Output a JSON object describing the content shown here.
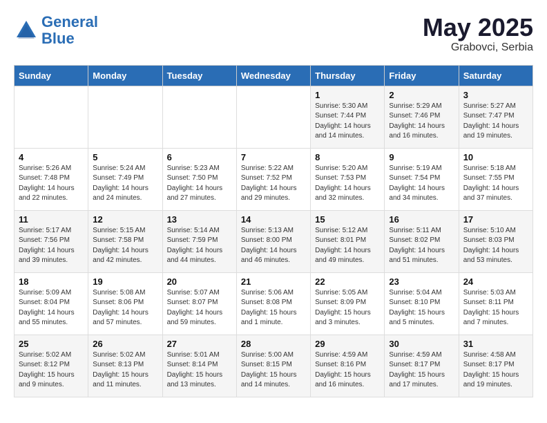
{
  "header": {
    "logo_line1": "General",
    "logo_line2": "Blue",
    "month_year": "May 2025",
    "location": "Grabovci, Serbia"
  },
  "days_of_week": [
    "Sunday",
    "Monday",
    "Tuesday",
    "Wednesday",
    "Thursday",
    "Friday",
    "Saturday"
  ],
  "weeks": [
    [
      {
        "day": "",
        "info": ""
      },
      {
        "day": "",
        "info": ""
      },
      {
        "day": "",
        "info": ""
      },
      {
        "day": "",
        "info": ""
      },
      {
        "day": "1",
        "info": "Sunrise: 5:30 AM\nSunset: 7:44 PM\nDaylight: 14 hours\nand 14 minutes."
      },
      {
        "day": "2",
        "info": "Sunrise: 5:29 AM\nSunset: 7:46 PM\nDaylight: 14 hours\nand 16 minutes."
      },
      {
        "day": "3",
        "info": "Sunrise: 5:27 AM\nSunset: 7:47 PM\nDaylight: 14 hours\nand 19 minutes."
      }
    ],
    [
      {
        "day": "4",
        "info": "Sunrise: 5:26 AM\nSunset: 7:48 PM\nDaylight: 14 hours\nand 22 minutes."
      },
      {
        "day": "5",
        "info": "Sunrise: 5:24 AM\nSunset: 7:49 PM\nDaylight: 14 hours\nand 24 minutes."
      },
      {
        "day": "6",
        "info": "Sunrise: 5:23 AM\nSunset: 7:50 PM\nDaylight: 14 hours\nand 27 minutes."
      },
      {
        "day": "7",
        "info": "Sunrise: 5:22 AM\nSunset: 7:52 PM\nDaylight: 14 hours\nand 29 minutes."
      },
      {
        "day": "8",
        "info": "Sunrise: 5:20 AM\nSunset: 7:53 PM\nDaylight: 14 hours\nand 32 minutes."
      },
      {
        "day": "9",
        "info": "Sunrise: 5:19 AM\nSunset: 7:54 PM\nDaylight: 14 hours\nand 34 minutes."
      },
      {
        "day": "10",
        "info": "Sunrise: 5:18 AM\nSunset: 7:55 PM\nDaylight: 14 hours\nand 37 minutes."
      }
    ],
    [
      {
        "day": "11",
        "info": "Sunrise: 5:17 AM\nSunset: 7:56 PM\nDaylight: 14 hours\nand 39 minutes."
      },
      {
        "day": "12",
        "info": "Sunrise: 5:15 AM\nSunset: 7:58 PM\nDaylight: 14 hours\nand 42 minutes."
      },
      {
        "day": "13",
        "info": "Sunrise: 5:14 AM\nSunset: 7:59 PM\nDaylight: 14 hours\nand 44 minutes."
      },
      {
        "day": "14",
        "info": "Sunrise: 5:13 AM\nSunset: 8:00 PM\nDaylight: 14 hours\nand 46 minutes."
      },
      {
        "day": "15",
        "info": "Sunrise: 5:12 AM\nSunset: 8:01 PM\nDaylight: 14 hours\nand 49 minutes."
      },
      {
        "day": "16",
        "info": "Sunrise: 5:11 AM\nSunset: 8:02 PM\nDaylight: 14 hours\nand 51 minutes."
      },
      {
        "day": "17",
        "info": "Sunrise: 5:10 AM\nSunset: 8:03 PM\nDaylight: 14 hours\nand 53 minutes."
      }
    ],
    [
      {
        "day": "18",
        "info": "Sunrise: 5:09 AM\nSunset: 8:04 PM\nDaylight: 14 hours\nand 55 minutes."
      },
      {
        "day": "19",
        "info": "Sunrise: 5:08 AM\nSunset: 8:06 PM\nDaylight: 14 hours\nand 57 minutes."
      },
      {
        "day": "20",
        "info": "Sunrise: 5:07 AM\nSunset: 8:07 PM\nDaylight: 14 hours\nand 59 minutes."
      },
      {
        "day": "21",
        "info": "Sunrise: 5:06 AM\nSunset: 8:08 PM\nDaylight: 15 hours\nand 1 minute."
      },
      {
        "day": "22",
        "info": "Sunrise: 5:05 AM\nSunset: 8:09 PM\nDaylight: 15 hours\nand 3 minutes."
      },
      {
        "day": "23",
        "info": "Sunrise: 5:04 AM\nSunset: 8:10 PM\nDaylight: 15 hours\nand 5 minutes."
      },
      {
        "day": "24",
        "info": "Sunrise: 5:03 AM\nSunset: 8:11 PM\nDaylight: 15 hours\nand 7 minutes."
      }
    ],
    [
      {
        "day": "25",
        "info": "Sunrise: 5:02 AM\nSunset: 8:12 PM\nDaylight: 15 hours\nand 9 minutes."
      },
      {
        "day": "26",
        "info": "Sunrise: 5:02 AM\nSunset: 8:13 PM\nDaylight: 15 hours\nand 11 minutes."
      },
      {
        "day": "27",
        "info": "Sunrise: 5:01 AM\nSunset: 8:14 PM\nDaylight: 15 hours\nand 13 minutes."
      },
      {
        "day": "28",
        "info": "Sunrise: 5:00 AM\nSunset: 8:15 PM\nDaylight: 15 hours\nand 14 minutes."
      },
      {
        "day": "29",
        "info": "Sunrise: 4:59 AM\nSunset: 8:16 PM\nDaylight: 15 hours\nand 16 minutes."
      },
      {
        "day": "30",
        "info": "Sunrise: 4:59 AM\nSunset: 8:17 PM\nDaylight: 15 hours\nand 17 minutes."
      },
      {
        "day": "31",
        "info": "Sunrise: 4:58 AM\nSunset: 8:17 PM\nDaylight: 15 hours\nand 19 minutes."
      }
    ]
  ]
}
